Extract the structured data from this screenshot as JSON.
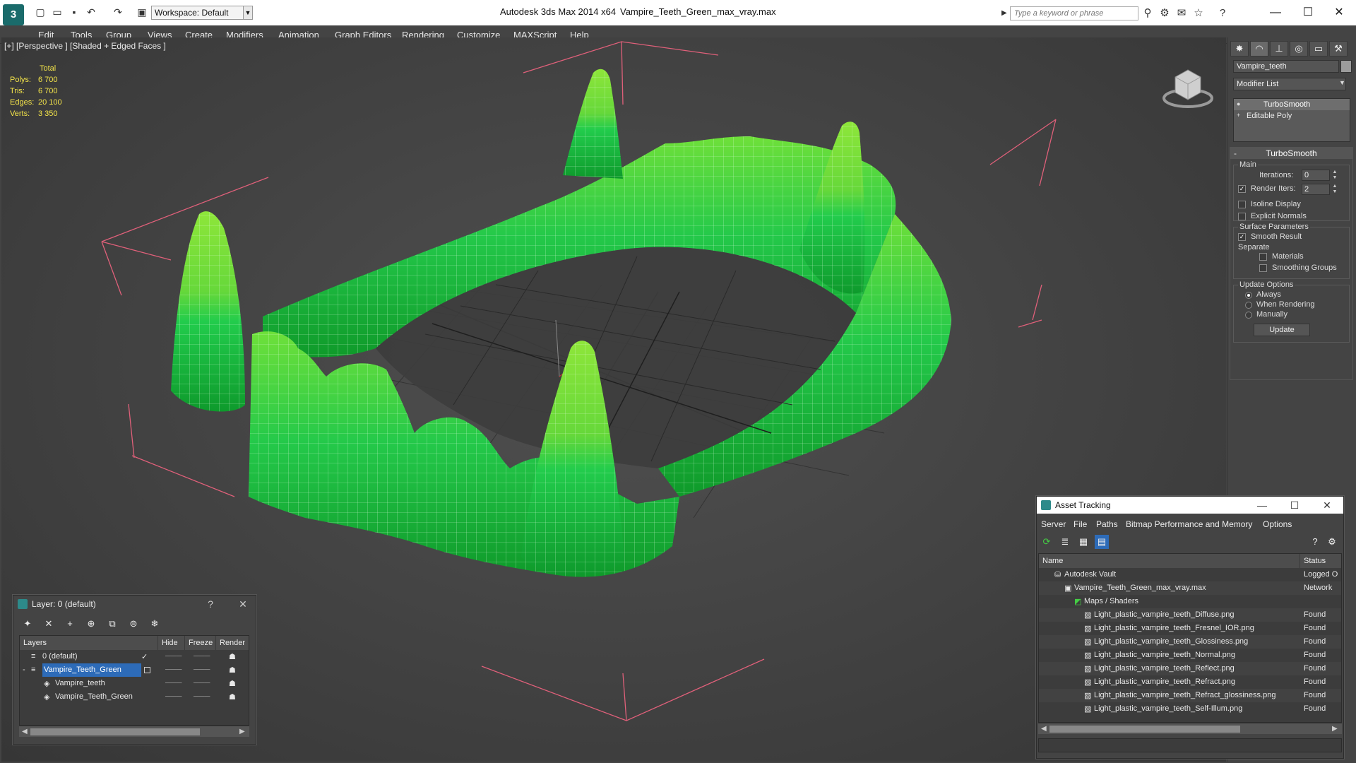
{
  "titlebar": {
    "app_title": "Autodesk 3ds Max  2014 x64",
    "file_name": "Vampire_Teeth_Green_max_vray.max",
    "workspace": "Workspace: Default",
    "search_placeholder": "Type a keyword or phrase"
  },
  "menu": [
    "Edit",
    "Tools",
    "Group",
    "Views",
    "Create",
    "Modifiers",
    "Animation",
    "Graph Editors",
    "Rendering",
    "Customize",
    "MAXScript",
    "Help"
  ],
  "viewport": {
    "label": "[+] [Perspective ] [Shaded + Edged Faces ]",
    "stats_header": "Total",
    "stats": [
      {
        "key": "Polys:",
        "value": "6 700"
      },
      {
        "key": "Tris:",
        "value": "6 700"
      },
      {
        "key": "Edges:",
        "value": "20 100"
      },
      {
        "key": "Verts:",
        "value": "3 350"
      }
    ]
  },
  "command_panel": {
    "object_name": "Vampire_teeth",
    "modifier_list": "Modifier List",
    "stack": [
      "TurboSmooth",
      "Editable Poly"
    ],
    "rollout_title": "TurboSmooth",
    "main_group": "Main",
    "iterations_label": "Iterations:",
    "iterations_value": "0",
    "render_iters_label": "Render Iters:",
    "render_iters_value": "2",
    "render_iters_checked": "✓",
    "isoline": "Isoline Display",
    "explicit_normals": "Explicit Normals",
    "surface_params": "Surface Parameters",
    "smooth_result": "Smooth Result",
    "smooth_result_checked": "✓",
    "separate": "Separate",
    "materials": "Materials",
    "smoothing_groups": "Smoothing Groups",
    "update_options": "Update Options",
    "always": "Always",
    "when_rendering": "When Rendering",
    "manually": "Manually",
    "update_button": "Update"
  },
  "layer_window": {
    "title": "Layer: 0 (default)",
    "help": "?",
    "columns": [
      "Layers",
      "Hide",
      "Freeze",
      "Render"
    ],
    "rows": [
      {
        "name": "0 (default)",
        "check": "✓"
      },
      {
        "name": "Vampire_Teeth_Green",
        "check": ""
      },
      {
        "name": "Vampire_teeth",
        "check": ""
      },
      {
        "name": "Vampire_Teeth_Green",
        "check": ""
      }
    ]
  },
  "asset_tracking": {
    "title": "Asset Tracking",
    "menu": [
      "Server",
      "File",
      "Paths",
      "Bitmap Performance and Memory",
      "Options"
    ],
    "columns": [
      "Name",
      "Status"
    ],
    "rows": [
      {
        "name": "Autodesk Vault",
        "status": "Logged O"
      },
      {
        "name": "Vampire_Teeth_Green_max_vray.max",
        "status": "Network"
      },
      {
        "name": "Maps / Shaders",
        "status": ""
      },
      {
        "name": "Light_plastic_vampire_teeth_Diffuse.png",
        "status": "Found"
      },
      {
        "name": "Light_plastic_vampire_teeth_Fresnel_IOR.png",
        "status": "Found"
      },
      {
        "name": "Light_plastic_vampire_teeth_Glossiness.png",
        "status": "Found"
      },
      {
        "name": "Light_plastic_vampire_teeth_Normal.png",
        "status": "Found"
      },
      {
        "name": "Light_plastic_vampire_teeth_Reflect.png",
        "status": "Found"
      },
      {
        "name": "Light_plastic_vampire_teeth_Refract.png",
        "status": "Found"
      },
      {
        "name": "Light_plastic_vampire_teeth_Refract_glossiness.png",
        "status": "Found"
      },
      {
        "name": "Light_plastic_vampire_teeth_Self-Illum.png",
        "status": "Found"
      }
    ]
  },
  "colors": {
    "model_green": "#2fcf3a",
    "stats_yellow": "#f5e54a",
    "selection_blue": "#2d6bb8",
    "bbox_pink": "#e0607a"
  }
}
